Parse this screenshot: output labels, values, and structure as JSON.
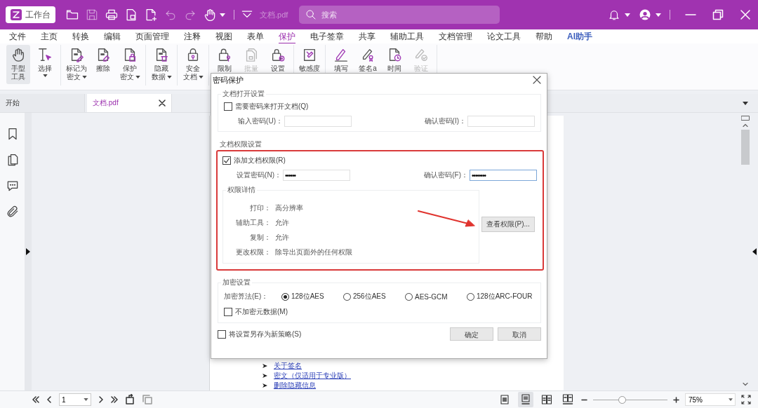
{
  "title_bar": {
    "workbench_button": "工作台",
    "quick_tools": [
      {
        "kind": "folder",
        "disabled": false
      },
      {
        "kind": "save",
        "disabled": true
      },
      {
        "kind": "print",
        "disabled": false
      },
      {
        "kind": "export",
        "disabled": false
      },
      {
        "kind": "new",
        "disabled": false
      },
      {
        "kind": "undo",
        "disabled": true
      },
      {
        "kind": "redo",
        "disabled": true
      },
      {
        "kind": "hand",
        "disabled": false,
        "dropdown": true
      }
    ],
    "document_name": "文档.pdf",
    "search": {
      "placeholder": "搜索"
    }
  },
  "menu": [
    {
      "label": "文件",
      "selected": false,
      "kind": "menu"
    },
    {
      "label": "主页",
      "selected": false,
      "kind": "menu"
    },
    {
      "label": "转换",
      "selected": false,
      "kind": "menu"
    },
    {
      "label": "编辑",
      "selected": false,
      "kind": "menu"
    },
    {
      "label": "页面管理",
      "selected": false,
      "kind": "menu"
    },
    {
      "label": "注释",
      "selected": false,
      "kind": "menu"
    },
    {
      "label": "视图",
      "selected": false,
      "kind": "menu"
    },
    {
      "label": "表单",
      "selected": false,
      "kind": "menu"
    },
    {
      "label": "保护",
      "selected": true,
      "kind": "menu"
    },
    {
      "label": "电子签章",
      "selected": false,
      "kind": "menu"
    },
    {
      "label": "共享",
      "selected": false,
      "kind": "menu"
    },
    {
      "label": "辅助工具",
      "selected": false,
      "kind": "menu"
    },
    {
      "label": "文档管理",
      "selected": false,
      "kind": "menu"
    },
    {
      "label": "论文工具",
      "selected": false,
      "kind": "menu"
    },
    {
      "label": "帮助",
      "selected": false,
      "kind": "menu"
    },
    {
      "label": "AI助手",
      "selected": false,
      "kind": "ai"
    }
  ],
  "ribbon": [
    {
      "tools": [
        {
          "lines": [
            "手型",
            "工具"
          ],
          "selected": true,
          "disabled": false,
          "dropdown": false
        },
        {
          "lines": [
            "选择"
          ],
          "selected": false,
          "disabled": false,
          "dropdown": true
        }
      ]
    },
    {
      "tools": [
        {
          "lines": [
            "标记为",
            "密文"
          ],
          "selected": false,
          "disabled": false,
          "dropdown": true
        },
        {
          "lines": [
            "擦除"
          ],
          "selected": false,
          "disabled": false,
          "dropdown": false
        },
        {
          "lines": [
            "保护",
            "密文"
          ],
          "selected": false,
          "disabled": false,
          "dropdown": true
        }
      ]
    },
    {
      "tools": [
        {
          "lines": [
            "隐藏",
            "数据"
          ],
          "selected": false,
          "disabled": false,
          "dropdown": true
        }
      ]
    },
    {
      "tools": [
        {
          "lines": [
            "安全",
            "文档"
          ],
          "selected": false,
          "disabled": false,
          "dropdown": true
        }
      ]
    },
    {
      "tools": [
        {
          "lines": [
            "限制"
          ],
          "selected": false,
          "disabled": false,
          "dropdown": false
        },
        {
          "lines": [
            "批量"
          ],
          "selected": false,
          "disabled": true,
          "dropdown": false
        },
        {
          "lines": [
            "设置"
          ],
          "selected": false,
          "disabled": false,
          "dropdown": false
        }
      ]
    },
    {
      "tools": [
        {
          "lines": [
            "敏感度"
          ],
          "selected": false,
          "disabled": false,
          "dropdown": false
        }
      ]
    },
    {
      "tools": [
        {
          "lines": [
            "填写"
          ],
          "selected": false,
          "disabled": false,
          "dropdown": false
        },
        {
          "lines": [
            "签名a"
          ],
          "selected": false,
          "disabled": false,
          "dropdown": false
        },
        {
          "lines": [
            "时间"
          ],
          "selected": false,
          "disabled": false,
          "dropdown": false
        },
        {
          "lines": [
            "验证"
          ],
          "selected": false,
          "disabled": true,
          "dropdown": false
        }
      ]
    }
  ],
  "tabs": [
    {
      "label": "开始",
      "selected": false,
      "closable": false
    },
    {
      "label": "文档.pdf",
      "selected": true,
      "closable": true
    }
  ],
  "sidebar": [
    {
      "kind": "bookmark"
    },
    {
      "kind": "pages"
    },
    {
      "kind": "comments"
    },
    {
      "kind": "attachment"
    }
  ],
  "document": {
    "links": [
      "关于签名",
      "密文（仅适用于专业版）",
      "删除隐藏信息"
    ]
  },
  "dialog": {
    "title": "密码保护",
    "open_settings": {
      "legend": "文档打开设置",
      "require": {
        "label": "需要密码来打开文档(Q)",
        "checked": false
      },
      "password_label": "输入密码(U)：",
      "confirm_label": "确认密码(I)："
    },
    "permissions": {
      "heading": "文档权限设置",
      "add": {
        "label": "添加文档权限(R)",
        "checked": true
      },
      "password": {
        "label": "设置密码(N)：",
        "value": "••••••",
        "focused": false
      },
      "confirm": {
        "label": "确认密码(F)：",
        "value": "••••••••",
        "focused": true
      },
      "details": {
        "legend": "权限详情",
        "rows": [
          {
            "label": "打印：",
            "value": "高分辨率"
          },
          {
            "label": "辅助工具：",
            "value": "允许"
          },
          {
            "label": "复制：",
            "value": "允许"
          },
          {
            "label": "更改权限：",
            "value": "除导出页面外的任何权限"
          }
        ]
      },
      "view_button": "查看权限(P)..."
    },
    "encryption": {
      "legend": "加密设置",
      "algorithm_label": "加密算法(E)：",
      "algorithms": [
        {
          "label": "128位AES",
          "selected": true
        },
        {
          "label": "256位AES",
          "selected": false
        },
        {
          "label": "AES-GCM",
          "selected": false
        },
        {
          "label": "128位ARC-FOUR",
          "selected": false
        }
      ],
      "no_metadata": {
        "label": "不加密元数据(M)",
        "checked": false
      }
    },
    "save_policy": {
      "label": "将设置另存为新策略(S)",
      "checked": false
    },
    "buttons": [
      "确定",
      "取消"
    ]
  },
  "status_bar": {
    "page": "1",
    "view_modes": [
      {
        "kind": "single",
        "selected": false
      },
      {
        "kind": "continuous",
        "selected": true
      },
      {
        "kind": "facing",
        "selected": false
      },
      {
        "kind": "facing-continuous",
        "selected": false
      }
    ],
    "zoom": {
      "level": 0.37,
      "value": "75%"
    }
  }
}
